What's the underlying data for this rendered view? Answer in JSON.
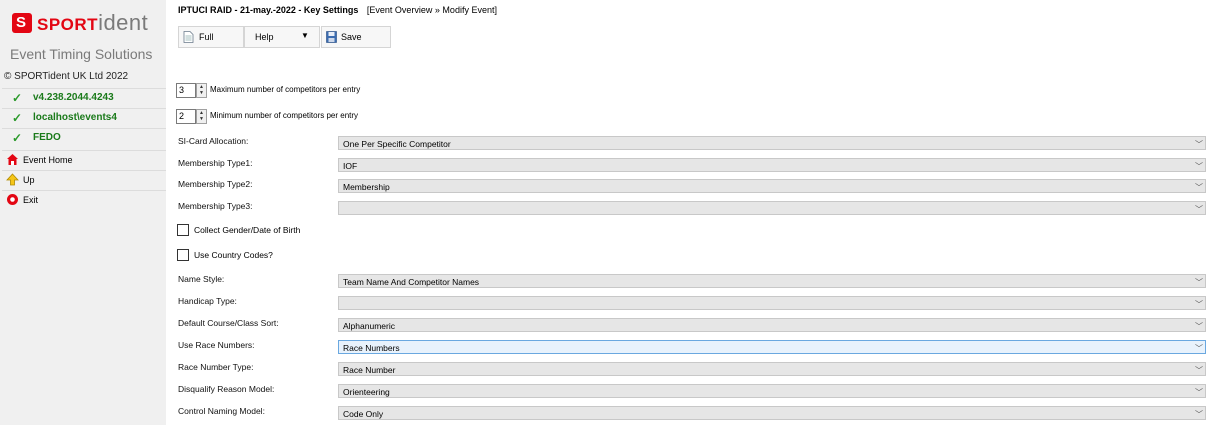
{
  "brand": {
    "logo_letter": "S",
    "logo_word_a": "SPORT",
    "logo_word_b": "ident",
    "tagline": "Event Timing Solutions",
    "copyright": "© SPORTident UK Ltd 2022"
  },
  "sidebar": {
    "status_items": [
      {
        "label": "v4.238.2044.4243",
        "icon": "check-icon"
      },
      {
        "label": "localhost\\events4",
        "icon": "check-icon"
      },
      {
        "label": "FEDO",
        "icon": "check-icon"
      }
    ],
    "nav_items": [
      {
        "label": "Event Home",
        "icon": "home-icon"
      },
      {
        "label": "Up",
        "icon": "up-arrow-icon"
      },
      {
        "label": "Exit",
        "icon": "exit-icon"
      }
    ]
  },
  "header": {
    "title": "IPTUCI RAID - 21-may.-2022 - Key Settings",
    "breadcrumb": "[Event Overview » Modify Event]"
  },
  "toolbar": {
    "full_label": "Full",
    "help_label": "Help",
    "save_label": "Save"
  },
  "spinners": [
    {
      "value": "3",
      "label": "Maximum number of competitors per entry"
    },
    {
      "value": "2",
      "label": "Minimum number of competitors per entry"
    }
  ],
  "fields_a": [
    {
      "label": "SI-Card Allocation:",
      "value": "One Per Specific Competitor"
    },
    {
      "label": "Membership Type1:",
      "value": "IOF"
    },
    {
      "label": "Membership Type2:",
      "value": "Membership"
    },
    {
      "label": "Membership Type3:",
      "value": ""
    }
  ],
  "checkboxes": [
    {
      "label": "Collect Gender/Date of Birth",
      "checked": false
    },
    {
      "label": "Use Country Codes?",
      "checked": false
    }
  ],
  "fields_b": [
    {
      "label": "Name Style:",
      "value": "Team Name And Competitor Names"
    },
    {
      "label": "Handicap Type:",
      "value": ""
    },
    {
      "label": "Default Course/Class Sort:",
      "value": "Alphanumeric"
    },
    {
      "label": "Use Race Numbers:",
      "value": "Race Numbers"
    },
    {
      "label": "Race Number Type:",
      "value": "Race Number"
    },
    {
      "label": "Disqualify Reason Model:",
      "value": "Orienteering"
    },
    {
      "label": "Control Naming Model:",
      "value": "Code Only"
    }
  ],
  "colors": {
    "brand_red": "#e30613",
    "status_green": "#1a7a1a",
    "focus_blue": "#6aa8e0"
  }
}
